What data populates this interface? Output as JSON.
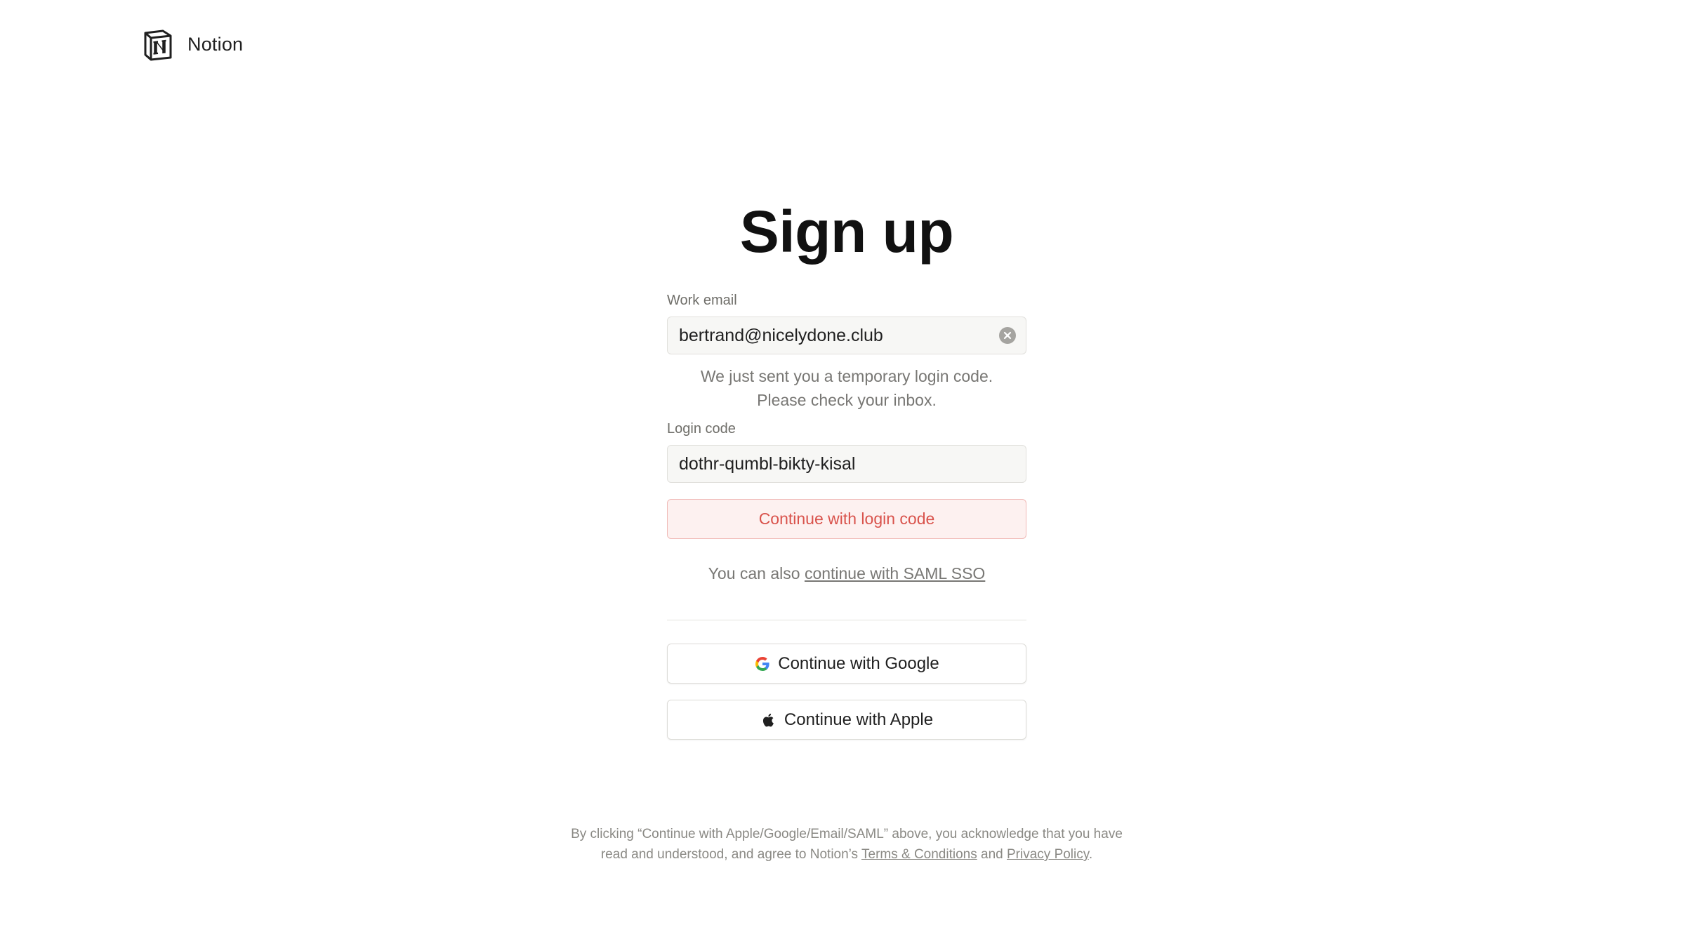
{
  "header": {
    "logo_icon": "notion-logo-icon",
    "brand_name": "Notion"
  },
  "form": {
    "title": "Sign up",
    "email": {
      "label": "Work email",
      "value": "bertrand@nicelydone.club",
      "clear_icon": "clear-circle-x-icon"
    },
    "hint_line1": "We just sent you a temporary login code.",
    "hint_line2": "Please check your inbox.",
    "code": {
      "label": "Login code",
      "value": "dothr-qumbl-bikty-kisal"
    },
    "continue_label": "Continue with login code",
    "sso_prefix": "You can also",
    "sso_link": "continue with SAML SSO"
  },
  "social": {
    "google_label": "Continue with Google",
    "google_icon": "google-icon",
    "apple_label": "Continue with Apple",
    "apple_icon": "apple-icon"
  },
  "legal": {
    "text_before": "By clicking “Continue with Apple/Google/Email/SAML” above, you acknowledge that you have read and understood, and agree to Notion’s",
    "terms_link": "Terms & Conditions",
    "and": "and",
    "privacy_link": "Privacy Policy",
    "period": "."
  },
  "colors": {
    "primary_text": "#d9534c",
    "primary_bg": "#fdf1f0",
    "primary_border": "#f0b9b6",
    "input_bg": "#f7f7f5",
    "muted_text": "#787774"
  }
}
